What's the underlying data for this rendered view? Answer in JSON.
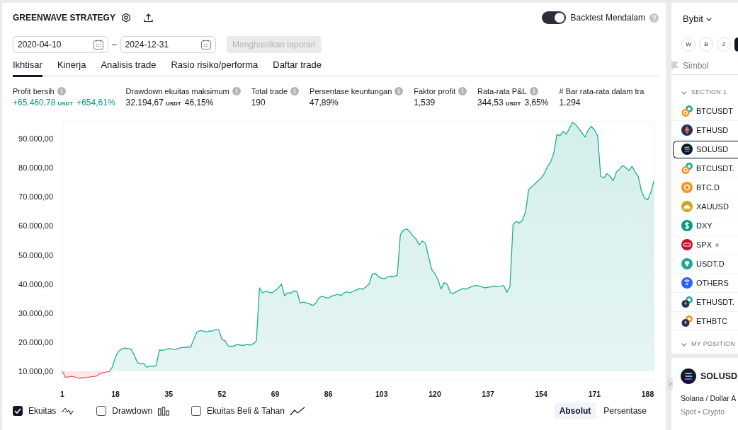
{
  "header": {
    "title": "GREENWAVE STRATEGY",
    "deep_backtest": {
      "label": "Backtest Mendalam",
      "on": true
    }
  },
  "date_range": {
    "start": "2020-04-10",
    "separator": "–",
    "end": "2024-12-31",
    "generate_button": {
      "label": "Menghasilkan laporan",
      "disabled": true
    }
  },
  "tabs": [
    {
      "label": "Ikhtisar",
      "selected": true
    },
    {
      "label": "Kinerja",
      "selected": false
    },
    {
      "label": "Analisis trade",
      "selected": false
    },
    {
      "label": "Rasio risiko/performa",
      "selected": false
    },
    {
      "label": "Daftar trade",
      "selected": false
    }
  ],
  "metrics": [
    {
      "label": "Profit bersih",
      "info": true,
      "value": "+65.460,78",
      "unit": "USDT",
      "change": "+654,61%",
      "color": "#089981"
    },
    {
      "label": "Drawdown ekuitas maksimum",
      "info": true,
      "value": "32.194,67",
      "unit": "USDT",
      "change": "46,15%",
      "color": "#131722"
    },
    {
      "label": "Total trade",
      "info": true,
      "value": "190",
      "color": "#131722"
    },
    {
      "label": "Persentase keuntungan",
      "info": true,
      "value": "47,89%",
      "color": "#131722"
    },
    {
      "label": "Faktor profit",
      "info": true,
      "value": "1,539",
      "color": "#131722"
    },
    {
      "label": "Rata-rata P&L",
      "info": true,
      "value": "344,53",
      "unit": "USDT",
      "change": "3,65%",
      "color": "#131722"
    },
    {
      "label": "# Bar rata-rata dalam tra",
      "info": false,
      "value": "1.294",
      "color": "#131722"
    }
  ],
  "chart": {
    "chart_data": {
      "type": "area",
      "x": [
        1,
        2,
        3,
        4,
        5,
        6,
        7,
        8,
        9,
        10,
        11,
        12,
        13,
        14,
        15,
        16,
        17,
        18,
        19,
        20,
        21,
        22,
        23,
        24,
        25,
        26,
        27,
        28,
        29,
        30,
        31,
        32,
        33,
        34,
        35,
        36,
        37,
        38,
        39,
        40,
        41,
        42,
        43,
        44,
        45,
        46,
        47,
        48,
        49,
        50,
        51,
        52,
        53,
        54,
        55,
        56,
        57,
        58,
        59,
        60,
        61,
        62,
        63,
        64,
        65,
        66,
        67,
        68,
        69,
        70,
        71,
        72,
        73,
        74,
        75,
        76,
        77,
        78,
        79,
        80,
        81,
        82,
        83,
        84,
        85,
        86,
        87,
        88,
        89,
        90,
        91,
        92,
        93,
        94,
        95,
        96,
        97,
        98,
        99,
        100,
        101,
        102,
        103,
        104,
        105,
        106,
        107,
        108,
        109,
        110,
        111,
        112,
        113,
        114,
        115,
        116,
        117,
        118,
        119,
        120,
        121,
        122,
        123,
        124,
        125,
        126,
        127,
        128,
        129,
        130,
        131,
        132,
        133,
        134,
        135,
        136,
        137,
        138,
        139,
        140,
        141,
        142,
        143,
        144,
        145,
        146,
        147,
        148,
        149,
        150,
        151,
        152,
        153,
        154,
        155,
        156,
        157,
        158,
        159,
        160,
        161,
        162,
        163,
        164,
        165,
        166,
        167,
        168,
        169,
        170,
        171,
        172,
        173,
        174,
        175,
        176,
        177,
        178,
        179,
        180,
        181,
        182,
        183,
        184,
        185,
        186,
        187,
        188,
        189,
        190
      ],
      "series": [
        {
          "color": "#22ab94",
          "values": [
            10000,
            7900,
            8100,
            8300,
            8000,
            7700,
            7700,
            7800,
            7900,
            8100,
            8200,
            8400,
            9200,
            9500,
            9700,
            9900,
            11500,
            15000,
            16800,
            17700,
            18000,
            17800,
            17600,
            15500,
            13000,
            12500,
            12700,
            11400,
            11800,
            11700,
            12000,
            17300,
            17200,
            17500,
            17800,
            17700,
            17500,
            17800,
            18200,
            18200,
            18400,
            18300,
            21000,
            23500,
            24000,
            23800,
            23500,
            23900,
            23800,
            24400,
            24200,
            21000,
            20500,
            18800,
            18500,
            18800,
            19300,
            19000,
            18900,
            19300,
            19000,
            19500,
            20400,
            38700,
            37000,
            37500,
            37200,
            37000,
            37800,
            38600,
            40000,
            36000,
            37000,
            36900,
            37600,
            37300,
            33500,
            33800,
            33500,
            33200,
            32600,
            33500,
            35300,
            35800,
            35400,
            35200,
            35800,
            36200,
            36500,
            36000,
            37000,
            37300,
            37000,
            37600,
            38000,
            38500,
            38200,
            39000,
            40000,
            43500,
            43600,
            42500,
            42000,
            41800,
            42500,
            42700,
            42600,
            43000,
            57000,
            58500,
            59000,
            58000,
            56500,
            55500,
            53500,
            54800,
            54000,
            49500,
            45000,
            43500,
            41500,
            38300,
            40500,
            39800,
            37000,
            36800,
            37500,
            38000,
            38500,
            38200,
            38800,
            39200,
            39500,
            39400,
            39000,
            38700,
            38900,
            39000,
            39300,
            39000,
            39200,
            39500,
            37200,
            39000,
            60500,
            61500,
            61000,
            62000,
            65000,
            72500,
            73500,
            74500,
            75500,
            76500,
            78000,
            80500,
            82000,
            85000,
            91500,
            91000,
            92500,
            91500,
            93500,
            95600,
            94800,
            93500,
            92000,
            90500,
            93000,
            94200,
            93000,
            91000,
            77000,
            76500,
            78000,
            77000,
            75500,
            78500,
            79500,
            80800,
            80000,
            79000,
            80500,
            78500,
            77000,
            72000,
            69500,
            69000,
            71500,
            75500
          ]
        }
      ],
      "xlim": [
        1,
        190
      ],
      "ylim": [
        7000,
        96000
      ],
      "xticks": [
        1,
        18,
        35,
        52,
        69,
        86,
        103,
        120,
        137,
        154,
        171,
        188
      ],
      "yticks": [
        {
          "value": 10000,
          "label": "10.000,00"
        },
        {
          "value": 20000,
          "label": "20.000,00"
        },
        {
          "value": 30000,
          "label": "30.000,00"
        },
        {
          "value": 40000,
          "label": "40.000,00"
        },
        {
          "value": 50000,
          "label": "50.000,00"
        },
        {
          "value": 60000,
          "label": "60.000,00"
        },
        {
          "value": 70000,
          "label": "70.000,00"
        },
        {
          "value": 80000,
          "label": "80.000,00"
        },
        {
          "value": 90000,
          "label": "90.000,00"
        }
      ]
    }
  },
  "legend": [
    {
      "kind": "equity",
      "label": "Ekuitas",
      "checked": true
    },
    {
      "kind": "drawdown",
      "label": "Drawdown",
      "checked": false
    },
    {
      "kind": "buyhold",
      "label": "Ekuitas Beli & Tahan",
      "checked": false
    }
  ],
  "scale_modes": [
    {
      "label": "Absolut",
      "selected": true
    },
    {
      "label": "Persentase",
      "selected": false
    }
  ],
  "sidebar": {
    "exchange": "Bybit",
    "chips": [
      {
        "label": "W",
        "selected": false
      },
      {
        "label": "B",
        "selected": false
      },
      {
        "label": "2",
        "selected": false
      },
      {
        "selected": true
      }
    ],
    "column_header": "Simbol",
    "sections": [
      {
        "title": "SECTION 1",
        "expanded": true,
        "items": [
          {
            "kind": "btcperp",
            "symbol": "BTCUSDT",
            "selected": false,
            "status_dot": false
          },
          {
            "kind": "eth",
            "symbol": "ETHUSD",
            "selected": false,
            "status_dot": false
          },
          {
            "kind": "sol",
            "symbol": "SOLUSD",
            "selected": true,
            "status_dot": false
          },
          {
            "kind": "btcperp",
            "symbol": "BTCUSDT.",
            "selected": false,
            "status_dot": false
          },
          {
            "kind": "btc",
            "symbol": "BTC.D",
            "selected": false,
            "status_dot": false
          },
          {
            "kind": "gold",
            "symbol": "XAUUSD",
            "selected": false,
            "status_dot": false
          },
          {
            "kind": "dollar",
            "symbol": "DXY",
            "selected": false,
            "status_dot": false
          },
          {
            "kind": "index",
            "symbol": "SPX",
            "selected": false,
            "status_dot": true
          },
          {
            "kind": "tether",
            "symbol": "USDT.D",
            "selected": false,
            "status_dot": false
          },
          {
            "kind": "others",
            "symbol": "OTHERS",
            "selected": false,
            "status_dot": false
          },
          {
            "kind": "ethperp",
            "symbol": "ETHUSDT.",
            "selected": false,
            "status_dot": false
          },
          {
            "kind": "ethbtc",
            "symbol": "ETHBTC",
            "selected": false,
            "status_dot": false
          }
        ]
      },
      {
        "title": "MY POSITION",
        "expanded": true
      }
    ]
  },
  "symbol_details": {
    "kind": "sol",
    "symbol": "SOLUSD",
    "description": "Solana / Dollar A",
    "category": "Spot • Crypto"
  }
}
